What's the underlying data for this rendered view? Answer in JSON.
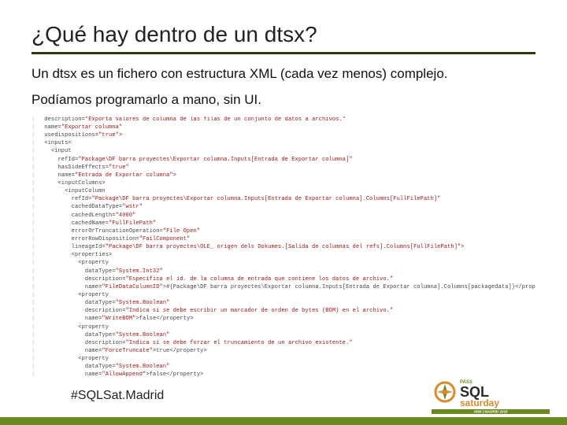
{
  "title": "¿Qué hay dentro de un dtsx?",
  "body": {
    "line1": "Un dtsx es un fichero con estructura XML (cada vez menos) complejo.",
    "line2": "Podíamos programarlo a mano, sin UI."
  },
  "code_lines": [
    "description=\"Exporta valores de columna de las filas de un conjunto de datos a archivos.\"",
    "name=\"Exportar columna\"",
    "usedispositions=\"true\">",
    "<inputs>",
    "  <input",
    "    refId=\"Package\\DF barra proyectes\\Exportar columna.Inputs[Entrada de Exportar columna]\"",
    "    hasSideEffects=\"true\"",
    "    name=\"Entrada de Exportar columna\">",
    "    <inputColumns>",
    "      <inputColumn",
    "        refId=\"Package\\DF barra proyectes\\Exportar columna.Inputs[Entrada de Exportar columna].Columns[FullFilePath]\"",
    "        cachedDataType=\"wstr\"",
    "        cachedLength=\"4000\"",
    "        cachedName=\"FullFilePath\"",
    "        errorOrTruncationOperation=\"File Open\"",
    "        errorRowDisposition=\"FailComponent\"",
    "        lineageId=\"Package\\DF barra proyectes\\OLE_ origen dels Dokumes.[Salida de columnas del refs].Columns[FullFilePath]\">",
    "        <properties>",
    "          <property",
    "            dataType=\"System.Int32\"",
    "            description=\"Especifica el id. de la columna de entrada que contiene los datos de archivo.\"",
    "            name=\"FileDataColumnID\">#{Package\\DF barra proyectes\\Exportar columna.Inputs[Entrada de Exportar columna].Columns[packagedata]}</property>",
    "          <property",
    "            dataType=\"System.Boolean\"",
    "            description=\"Indica si se debe escribir un marcador de orden de bytes (BOM) en el archivo.\"",
    "            name=\"WriteBOM\">false</property>",
    "          <property",
    "            dataType=\"System.Boolean\"",
    "            description=\"Indica si se debe forzar el truncamiento de un archivo existente.\"",
    "            name=\"ForceTruncate\">true</property>",
    "          <property",
    "            dataType=\"System.Boolean\"",
    "            name=\"AllowAppend\">false</property>"
  ],
  "hashtag": "#SQLSat.Madrid",
  "event": {
    "brand_top": "PASS",
    "brand_main_1": "SQL",
    "brand_main_2": "saturday",
    "edition": "#569 | MADRID 2016"
  },
  "colors": {
    "accent_green": "#6a8a1f",
    "rule_dark": "#2b3a13",
    "logo_orange": "#d98a2e",
    "logo_dark": "#2a2a2a"
  }
}
